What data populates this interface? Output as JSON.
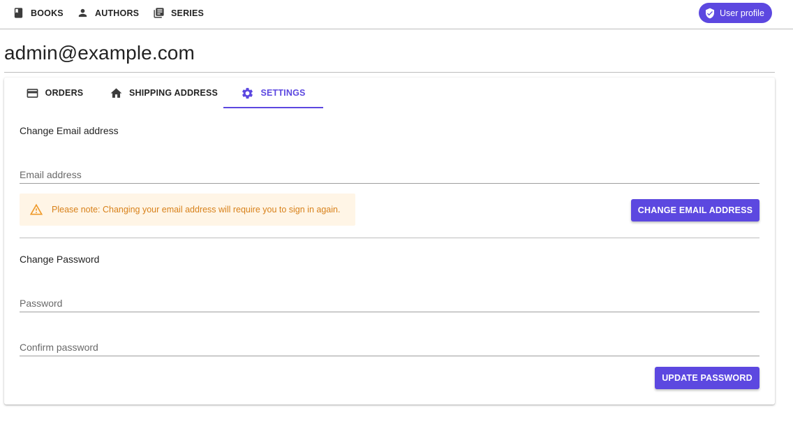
{
  "nav": {
    "books": "BOOKS",
    "authors": "AUTHORS",
    "series": "SERIES",
    "user_profile": "User profile"
  },
  "page": {
    "title": "admin@example.com"
  },
  "tabs": {
    "orders": "ORDERS",
    "shipping": "SHIPPING ADDRESS",
    "settings": "SETTINGS",
    "active": "settings"
  },
  "email_section": {
    "heading": "Change Email address",
    "email_placeholder": "Email address",
    "email_value": "",
    "note": "Please note: Changing your email address will require you to sign in again.",
    "submit": "CHANGE EMAIL ADDRESS"
  },
  "password_section": {
    "heading": "Change Password",
    "password_placeholder": "Password",
    "confirm_placeholder": "Confirm password",
    "submit": "UPDATE PASSWORD"
  },
  "colors": {
    "accent": "#5c48e0",
    "warning_bg": "#fff5e6",
    "warning_text": "#d8811a"
  }
}
